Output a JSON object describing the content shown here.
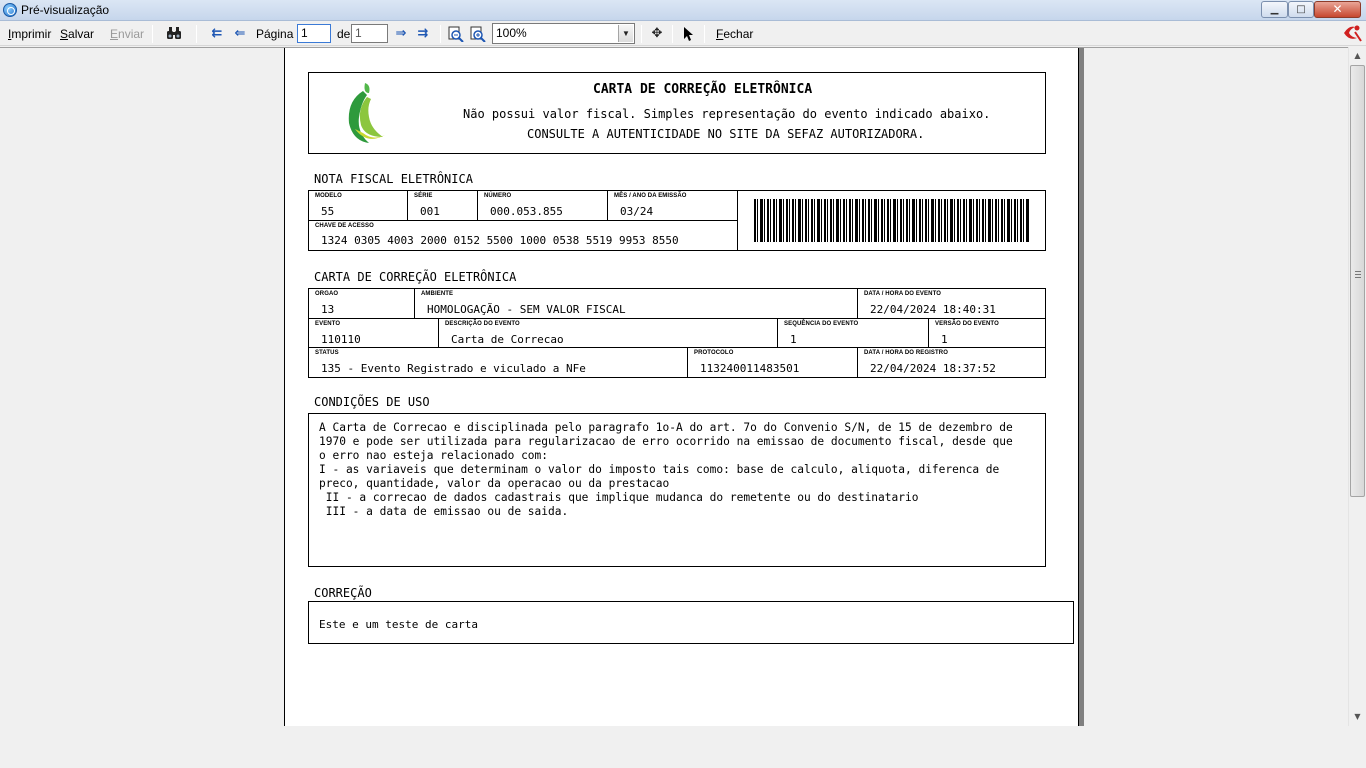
{
  "window": {
    "title": "Pré-visualização",
    "buttons": {
      "minimize": "▁",
      "maximize": "□",
      "close": "✕"
    }
  },
  "toolbar": {
    "print": {
      "first": "I",
      "rest": "mprimir"
    },
    "save": {
      "first": "S",
      "rest": "alvar"
    },
    "send": {
      "first": "E",
      "rest": "nviar"
    },
    "page_label": "Página",
    "page_value": "1",
    "of_label": "de",
    "total_pages": "1",
    "zoom": "100%",
    "close": {
      "first": "F",
      "rest": "echar"
    },
    "icons": [
      "binoculars-icon",
      "first-page-icon",
      "previous-page-icon",
      "next-page-icon",
      "last-page-icon",
      "zoom-out-icon",
      "zoom-in-icon",
      "move-page-icon",
      "pointer-icon",
      "app-logo-icon"
    ]
  },
  "document": {
    "header": {
      "title": "CARTA DE CORREÇÃO ELETRÔNICA",
      "line1": "Não possui valor fiscal. Simples representação do evento indicado abaixo.",
      "line2": "CONSULTE A AUTENTICIDADE NO SITE DA SEFAZ AUTORIZADORA."
    },
    "nfe": {
      "section_title": "NOTA FISCAL ELETRÔNICA",
      "modelo_label": "MODELO",
      "modelo": "55",
      "serie_label": "SÉRIE",
      "serie": "001",
      "numero_label": "NÚMERO",
      "numero": "000.053.855",
      "mes_ano_label": "MÊS / ANO DA EMISSÃO",
      "mes_ano": "03/24",
      "chave_label": "CHAVE DE ACESSO",
      "chave": "1324 0305 4003 2000 0152 5500 1000 0538 5519 9953 8550"
    },
    "cce": {
      "section_title": "CARTA DE CORREÇÃO ELETRÔNICA",
      "orgao_label": "ORGAO",
      "orgao": "13",
      "ambiente_label": "AMBIENTE",
      "ambiente": "HOMOLOGAÇÃO - SEM VALOR FISCAL",
      "data_evento_label": "DATA / HORA DO EVENTO",
      "data_evento": "22/04/2024 18:40:31",
      "evento_label": "EVENTO",
      "evento": "110110",
      "descricao_label": "DESCRIÇÃO DO EVENTO",
      "descricao": "Carta de Correcao",
      "sequencia_label": "SEQUÊNCIA DO EVENTO",
      "sequencia": "1",
      "versao_label": "VERSÃO DO EVENTO",
      "versao": "1",
      "status_label": "STATUS",
      "status": "135 - Evento Registrado e viculado a NFe",
      "protocolo_label": "PROTOCOLO",
      "protocolo": "113240011483501",
      "data_registro_label": "DATA / HORA DO REGISTRO",
      "data_registro": "22/04/2024 18:37:52"
    },
    "conditions": {
      "section_title": "CONDIÇÕES DE USO",
      "text": "A Carta de Correcao e disciplinada pelo paragrafo 1o-A do art. 7o do Convenio S/N, de 15 de dezembro de\n1970 e pode ser utilizada para regularizacao de erro ocorrido na emissao de documento fiscal, desde que\no erro nao esteja relacionado com:\nI - as variaveis que determinam o valor do imposto tais como: base de calculo, aliquota, diferenca de\npreco, quantidade, valor da operacao ou da prestacao\n II - a correcao de dados cadastrais que implique mudanca do remetente ou do destinatario\n III - a data de emissao ou de saida."
    },
    "correction": {
      "section_title": "CORREÇÃO",
      "text": "Este e um teste de carta"
    }
  }
}
